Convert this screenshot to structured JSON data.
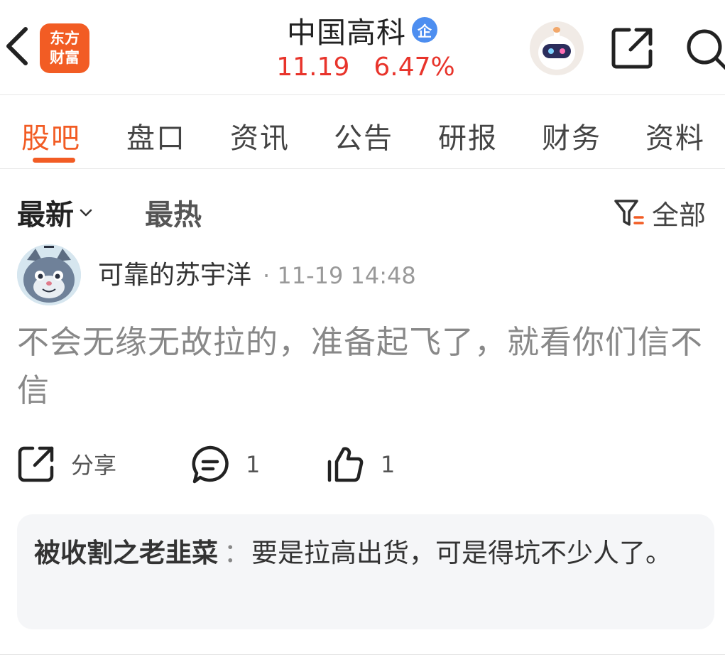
{
  "header": {
    "logo_line1": "东方",
    "logo_line2": "财富",
    "stock_name": "中国高科",
    "enterprise_badge": "企",
    "price": "11.19",
    "change_pct": "6.47%",
    "icons": [
      "back-icon",
      "robot-assistant-icon",
      "share-icon",
      "search-icon"
    ]
  },
  "tabs": [
    {
      "label": "股吧",
      "active": true
    },
    {
      "label": "盘口",
      "active": false
    },
    {
      "label": "资讯",
      "active": false
    },
    {
      "label": "公告",
      "active": false
    },
    {
      "label": "研报",
      "active": false
    },
    {
      "label": "财务",
      "active": false
    },
    {
      "label": "资料",
      "active": false
    }
  ],
  "sort": {
    "latest_label": "最新",
    "hot_label": "最热",
    "filter_label": "全部"
  },
  "post": {
    "author": "可靠的苏宇洋",
    "time": "11-19 14:48",
    "content": "不会无缘无故拉的，准备起飞了，就看你们信不信",
    "share_label": "分享",
    "comment_count": "1",
    "like_count": "1"
  },
  "reply": {
    "author": "被收割之老韭菜",
    "separator": "：",
    "text": "要是拉高出货，可是得坑不少人了。"
  },
  "colors": {
    "accent": "#f25c24",
    "price_up": "#e8342b",
    "badge_blue": "#4d8ef0",
    "reply_bg": "#f5f6f8"
  }
}
